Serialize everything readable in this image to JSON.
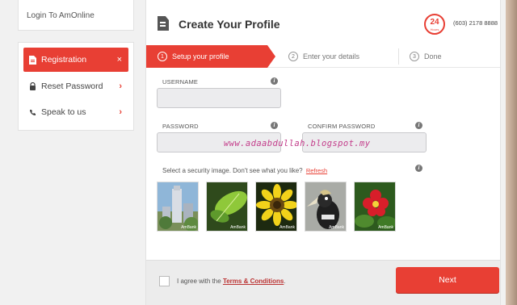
{
  "sidebar": {
    "login_link": "Login To AmOnline",
    "items": [
      {
        "label": "Registration",
        "icon": "document-icon",
        "active": true
      },
      {
        "label": "Reset Password",
        "icon": "lock-icon"
      },
      {
        "label": "Speak to us",
        "icon": "phone-icon"
      }
    ],
    "close_glyph": "×",
    "chevron_glyph": "›"
  },
  "header": {
    "title": "Create Your Profile",
    "badge_number": "24",
    "badge_text": "Hours",
    "phone": "(603) 2178 8888"
  },
  "steps": [
    {
      "num": "1",
      "label": "Setup your profile",
      "active": true
    },
    {
      "num": "2",
      "label": "Enter your details"
    },
    {
      "num": "3",
      "label": "Done"
    }
  ],
  "form": {
    "username_label": "USERNAME",
    "password_label": "PASSWORD",
    "confirm_label": "CONFIRM PASSWORD",
    "info_glyph": "i",
    "username_value": "",
    "password_value": "",
    "confirm_value": ""
  },
  "watermark": "www.adaabdullah.blogspot.my",
  "security": {
    "prompt": "Select a security image. Don't see what you like?",
    "refresh": "Refresh",
    "brand": "AmBank",
    "images": [
      {
        "name": "tower"
      },
      {
        "name": "leaf"
      },
      {
        "name": "sunflower"
      },
      {
        "name": "hornbill"
      },
      {
        "name": "red-flower"
      }
    ]
  },
  "footer": {
    "agree_prefix": "I agree with the",
    "terms": "Terms & Conditions",
    "agree_suffix": ".",
    "next_label": "Next"
  },
  "colors": {
    "accent": "#e83f34"
  }
}
